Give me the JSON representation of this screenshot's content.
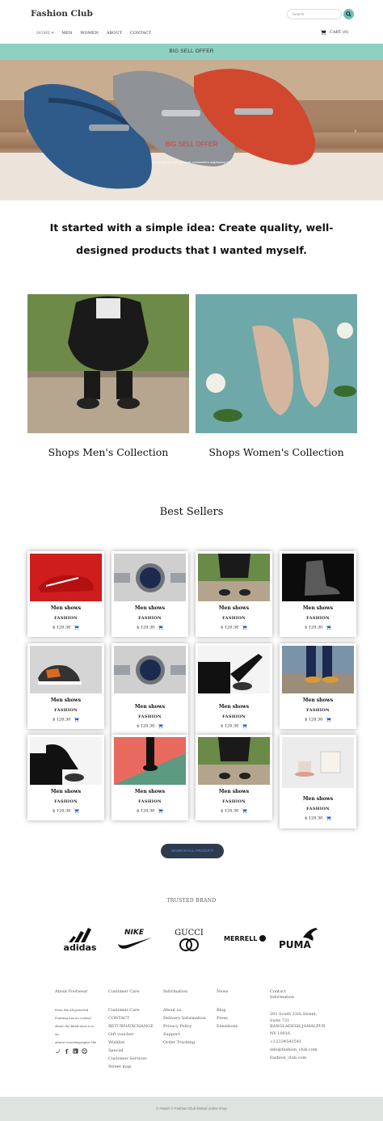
{
  "header": {
    "logo": "Fashion Club",
    "search_placeholder": "Search",
    "nav": [
      {
        "label": "HOME ▾"
      },
      {
        "label": "MEN"
      },
      {
        "label": "WOMEN"
      },
      {
        "label": "ABOUT"
      },
      {
        "label": "CONTACT"
      }
    ],
    "cart_label": "CART (0)"
  },
  "offer_bar": "BIG SELL OFFER",
  "hero": {
    "title": "BIG SELL OFFER",
    "subtitle": "Lorem ipsum dolor sit amet, consectetur adipisicing elit.",
    "prev": "‹",
    "next": "›"
  },
  "tagline": "It started with a simple idea: Create quality, well-designed products that I wanted myself.",
  "collections": {
    "men": "Shops Men's Collection",
    "women": "Shops Women's Collection"
  },
  "best_sellers": {
    "title": "Best Sellers",
    "products": [
      {
        "name": "Men shows",
        "category": "FASHION",
        "price": "$ 120.30"
      },
      {
        "name": "Men shows",
        "category": "FASHION",
        "price": "$ 120.30"
      },
      {
        "name": "Men shows",
        "category": "FASHION",
        "price": "$ 120.30"
      },
      {
        "name": "Men shows",
        "category": "FASHION",
        "price": "$ 120.30"
      },
      {
        "name": "Men shows",
        "category": "FASHION",
        "price": "$ 120.30"
      },
      {
        "name": "Men shows",
        "category": "FASHION",
        "price": "$ 120.30"
      },
      {
        "name": "Men shows",
        "category": "FASHION",
        "price": "$ 120.30"
      },
      {
        "name": "Men shows",
        "category": "FASHION",
        "price": "$ 120.30"
      },
      {
        "name": "Men shows",
        "category": "FASHION",
        "price": "$ 120.30"
      },
      {
        "name": "Men shows",
        "category": "FASHION",
        "price": "$ 120.30"
      },
      {
        "name": "Men shows",
        "category": "FASHION",
        "price": "$ 120.30"
      },
      {
        "name": "Men shows",
        "category": "FASHION",
        "price": "$ 120.30"
      }
    ],
    "search_all_label": "SEARCH ALL PRODUCT"
  },
  "trusted_brand": {
    "title": "TRUSTED BRAND",
    "brands": [
      "adidas",
      "NIKE",
      "GUCCI",
      "MERRELL",
      "PUMA"
    ]
  },
  "footer": {
    "about": {
      "heading": "About Footwear",
      "text": [
        "Even the all-powerful",
        "Pointing has no control",
        "about the blind texts it is",
        "an",
        "almost unorthographic life"
      ]
    },
    "customer_care": {
      "heading": "Customer Care",
      "items": [
        "Customer Care",
        "CONTACT",
        "RETURN/EXCHANGE",
        "Gift voucher",
        "Wishlist",
        "Special",
        "Customer Services",
        "Street map"
      ]
    },
    "information": {
      "heading": "Information",
      "items": [
        "About us",
        "Delivery Information",
        "Privacy Policy",
        "Support",
        "Order Tracking"
      ]
    },
    "news": {
      "heading": "News",
      "items": [
        "Blog",
        "Press",
        "Exexitions"
      ]
    },
    "contact": {
      "heading": "Contact Information",
      "lines": [
        "291 South 21th Street,",
        "Suite 721",
        "BANGLADESH,JAMALPUR",
        "NY 10016",
        "+12334542541",
        "info@fashion_club.com",
        "Fashion_club.com"
      ]
    }
  },
  "copyright": "© Akash ©   Fashion Club limited online shop"
}
